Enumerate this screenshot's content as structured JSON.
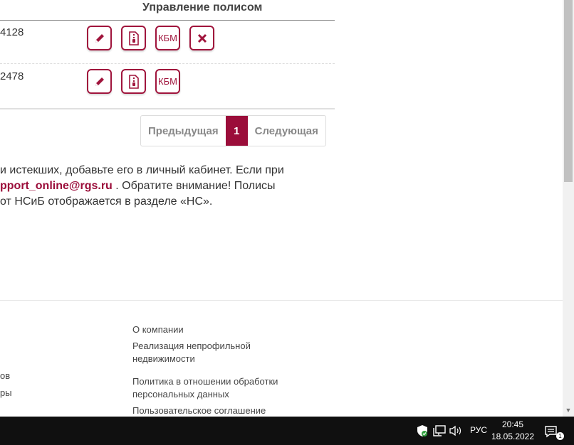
{
  "table": {
    "column_header": "Управление полисом",
    "rows": [
      {
        "policy_number_fragment": "4128",
        "actions": [
          "edit",
          "document",
          "КБМ",
          "delete"
        ]
      },
      {
        "policy_number_fragment": "2478",
        "actions": [
          "edit",
          "document",
          "КБМ"
        ]
      }
    ],
    "kbm_label": "КБМ"
  },
  "pagination": {
    "previous_label": "Предыдущая",
    "current_page": "1",
    "next_label": "Следующая"
  },
  "info": {
    "line1": "и истекших, добавьте его в личный кабинет. Если при",
    "email": "pport_online@rgs.ru",
    "line2_rest": " . Обратите внимание! Полисы",
    "line3": "от НСиБ отображается в разделе «НС»."
  },
  "footer": {
    "left_fragment_1": "ов",
    "left_fragment_2": "ры",
    "links": [
      "О компании",
      "Реализация непрофильной",
      "недвижимости",
      "Политика в отношении обработки",
      "персональных данных",
      "Пользовательское соглашение"
    ]
  },
  "taskbar": {
    "language": "РУС",
    "time": "20:45",
    "date": "18.05.2022",
    "notification_count": "1"
  },
  "colors": {
    "brand": "#9b0d3a",
    "taskbar": "#101010"
  }
}
